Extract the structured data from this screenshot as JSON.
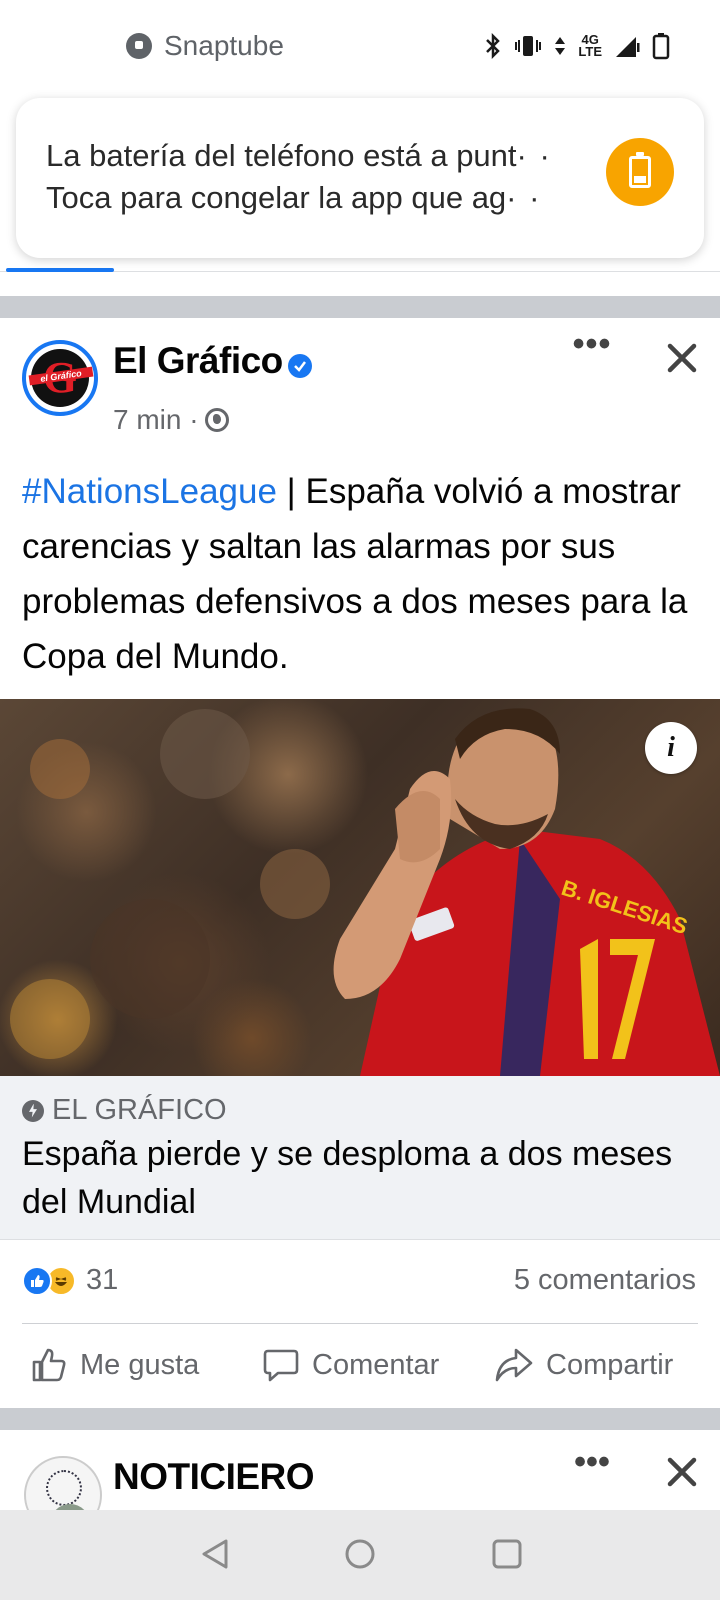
{
  "status_bar": {
    "app_name": "Snaptube",
    "network": "4G",
    "network_sub": "LTE",
    "icons": [
      "bluetooth-icon",
      "vibrate-icon",
      "data-arrows-icon",
      "signal-icon",
      "battery-icon"
    ]
  },
  "notification": {
    "line1": "La batería del teléfono está a punt",
    "line2": "Toca para congelar la app que ag",
    "ellipsis": "· ·",
    "accent_color": "#f8a400",
    "icon": "battery-icon"
  },
  "post": {
    "page_name": "El Gráfico",
    "time": "7 min ·",
    "avatar_letter": "G",
    "avatar_text": "el Gráfico",
    "more_label": "•••",
    "hashtag": "#NationsLeague",
    "body": " | España volvió a mostrar carencias y saltan las alarmas por sus problemas defensivos a dos meses para la Copa del Mundo.",
    "info_label": "i",
    "link_source": "EL GRÁFICO",
    "link_title": "España pierde y se desploma a dos meses del Mundial",
    "reaction_count": "31",
    "comments": "5 comentarios",
    "actions": {
      "like": "Me gusta",
      "comment": "Comentar",
      "share": "Compartir"
    }
  },
  "next_post": {
    "page_name": "NOTICIERO",
    "more_label": "•••"
  },
  "colors": {
    "facebook_blue": "#1877f2",
    "link_blue": "#1b74e4",
    "muted": "#65676b",
    "separator": "#c9ccd1"
  }
}
